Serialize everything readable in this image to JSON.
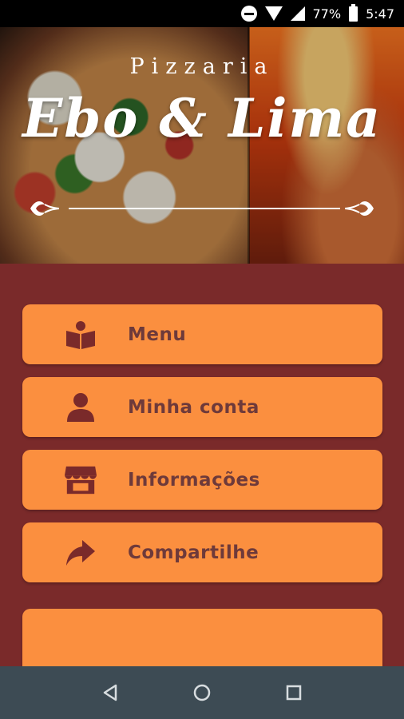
{
  "status_bar": {
    "battery_percent": "77%",
    "time": "5:47",
    "icons": [
      "do-not-disturb-icon",
      "wifi-icon",
      "signal-icon",
      "battery-icon"
    ]
  },
  "hero": {
    "brand_small": "Pizzaria",
    "brand_big": "Ebo & Lima"
  },
  "menu": {
    "items": [
      {
        "label": "Menu",
        "icon": "book-reader-icon"
      },
      {
        "label": "Minha conta",
        "icon": "user-icon"
      },
      {
        "label": "Informações",
        "icon": "store-icon"
      },
      {
        "label": "Compartilhe",
        "icon": "share-arrow-icon"
      }
    ]
  },
  "colors": {
    "background": "#7a2a2a",
    "button": "#fb8f3f",
    "button_text": "#6e3a3a",
    "icon": "#7a2a2a",
    "navbar": "#3d4b54"
  },
  "navbar": {
    "buttons": [
      "back-icon",
      "home-icon",
      "recents-icon"
    ]
  }
}
